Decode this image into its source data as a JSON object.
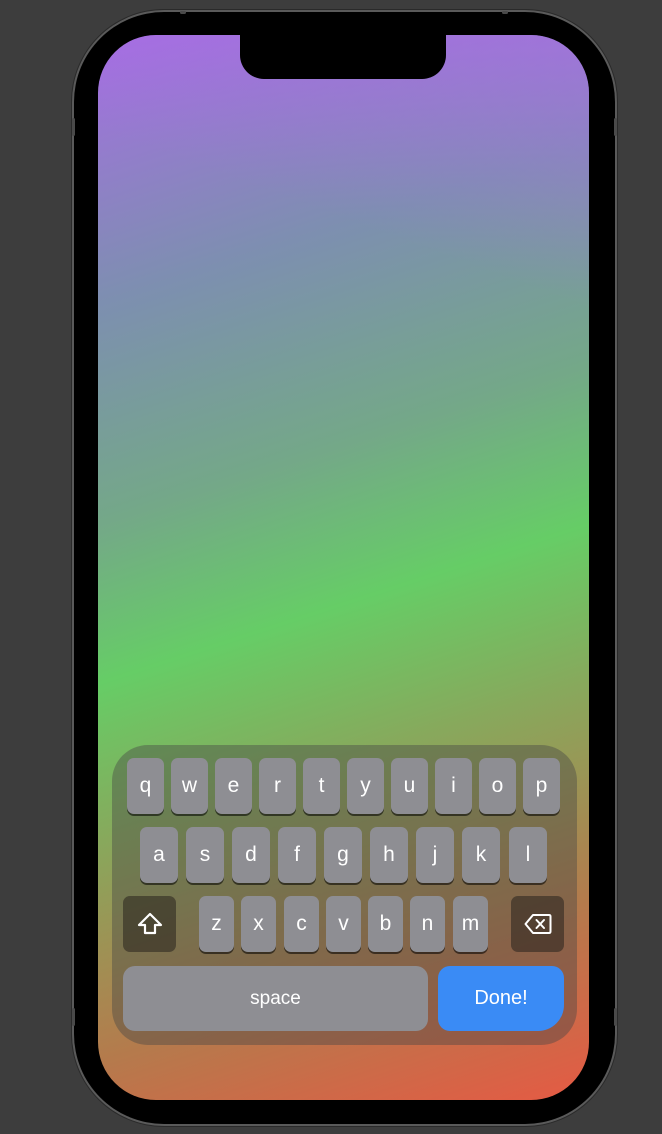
{
  "keyboard": {
    "row1": [
      "q",
      "w",
      "e",
      "r",
      "t",
      "y",
      "u",
      "i",
      "o",
      "p"
    ],
    "row2": [
      "a",
      "s",
      "d",
      "f",
      "g",
      "h",
      "j",
      "k",
      "l"
    ],
    "row3": [
      "z",
      "x",
      "c",
      "v",
      "b",
      "n",
      "m"
    ],
    "space_label": "space",
    "done_label": "Done!",
    "shift_icon": "shift-icon",
    "delete_icon": "delete-backspace-icon"
  },
  "colors": {
    "done_button": "#3a8bf5",
    "key_background": "#8e8e93",
    "gradient_top": "#a56ee2",
    "gradient_middle": "#66cd66",
    "gradient_bottom": "#e55a44"
  }
}
